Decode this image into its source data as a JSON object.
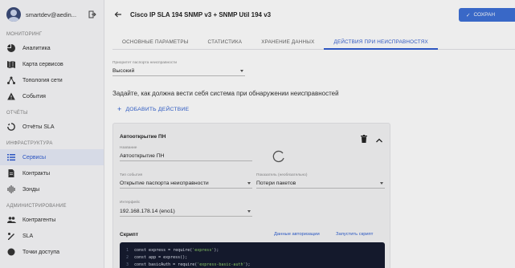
{
  "colors": {
    "accent": "#2f5bd0",
    "button": "#3c6fd6",
    "code_bg": "#141a2e"
  },
  "user": {
    "name": "smartdev@aedin..."
  },
  "sidebar": {
    "sections": [
      {
        "title": "МОНИТОРИНГ",
        "items": [
          {
            "label": "Аналитика",
            "icon": "pie-chart-icon"
          },
          {
            "label": "Карта сервисов",
            "icon": "map-icon"
          },
          {
            "label": "Топология сети",
            "icon": "topology-icon"
          },
          {
            "label": "События",
            "icon": "warning-icon"
          }
        ]
      },
      {
        "title": "ОТЧЁТЫ",
        "items": [
          {
            "label": "Отчёты SLA",
            "icon": "circle-report-icon"
          }
        ]
      },
      {
        "title": "ИНФРАСТРУКТУРА",
        "items": [
          {
            "label": "Сервисы",
            "icon": "list-icon",
            "active": true
          },
          {
            "label": "Контракты",
            "icon": "document-icon"
          },
          {
            "label": "Зонды",
            "icon": "probe-icon"
          }
        ]
      },
      {
        "title": "АДМИНИСТРИРОВАНИЕ",
        "items": [
          {
            "label": "Контрагенты",
            "icon": "people-icon"
          },
          {
            "label": "SLA",
            "icon": "sla-icon"
          },
          {
            "label": "Точки доступа",
            "icon": "access-point-icon"
          }
        ]
      }
    ]
  },
  "header": {
    "title": "Cisco IP SLA 194 SNMP v3 + SNMP Util 194 v3",
    "save_label": "СОХРАН"
  },
  "tabs": [
    {
      "label": "ОСНОВНЫЕ ПАРАМЕТРЫ"
    },
    {
      "label": "СТАТИСТИКА"
    },
    {
      "label": "ХРАНЕНИЕ ДАННЫХ"
    },
    {
      "label": "ДЕЙСТВИЯ ПРИ НЕИСПРАВНОСТЯХ",
      "active": true
    }
  ],
  "priority": {
    "label": "Приоритет паспорта неисправности",
    "value": "Высокий"
  },
  "prompt": "Задайте, как должна вести себя система при обнаружении неисправностей",
  "add_action_label": "ДОБАВИТЬ ДЕЙСТВИЕ",
  "action_card": {
    "title": "Автооткрытие ПН",
    "name_label": "Название",
    "name_value": "Автооткрытие ПН",
    "event_type_label": "Тип события",
    "event_type_value": "Открытие паспорта неисправности",
    "metric_label": "Показатель (необязательно)",
    "metric_value": "Потери пакетов",
    "interface_label": "Интерфейс",
    "interface_value": "192.168.178.14 (eno1)",
    "script_title": "Скрипт",
    "auth_link": "Данные авторизации",
    "run_link": "Запустить скрипт",
    "code_lines": [
      {
        "num": "1",
        "pre": "const express = require(",
        "str": "'express'",
        "post": ");"
      },
      {
        "num": "2",
        "pre": "const app = express();",
        "str": "",
        "post": ""
      },
      {
        "num": "3",
        "pre": "const basicAuth = require(",
        "str": "'express-basic-auth'",
        "post": ");"
      }
    ]
  }
}
